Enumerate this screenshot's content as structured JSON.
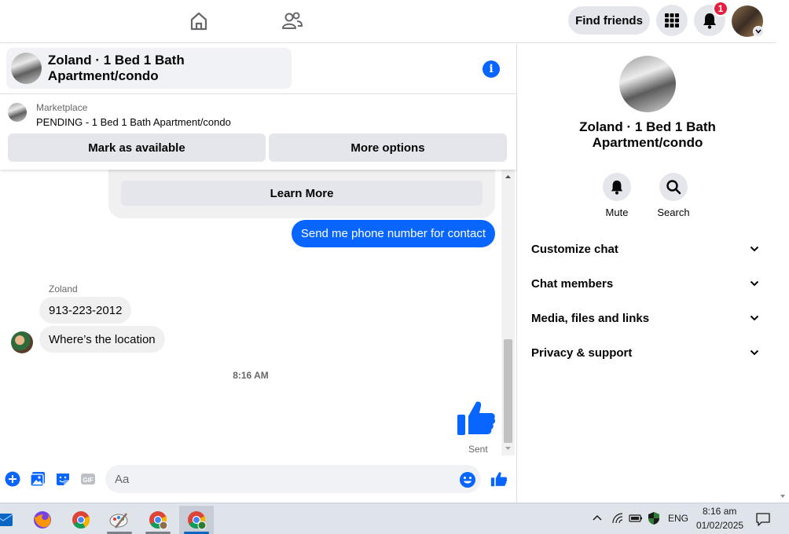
{
  "nav": {
    "find_friends": "Find friends",
    "notification_count": "1"
  },
  "chat": {
    "title": "Zoland · 1 Bed 1 Bath Apartment/condo"
  },
  "marketplace": {
    "label": "Marketplace",
    "status": "PENDING - 1 Bed 1 Bath Apartment/condo",
    "mark_available": "Mark as available",
    "more_options": "More options"
  },
  "messages": {
    "learn_more": "Learn More",
    "outgoing_1": "Send me phone number for contact",
    "sender_name": "Zoland",
    "incoming_1": "913-223-2012",
    "incoming_2": "Where’s the location",
    "timestamp": "8:16 AM",
    "sent_label": "Sent"
  },
  "composer": {
    "placeholder": "Aa"
  },
  "right_panel": {
    "title": "Zoland · 1 Bed 1 Bath Apartment/condo",
    "mute_label": "Mute",
    "search_label": "Search",
    "sections": [
      "Customize chat",
      "Chat members",
      "Media, files and links",
      "Privacy & support"
    ]
  },
  "taskbar": {
    "language": "ENG",
    "time": "8:16 am",
    "date": "01/02/2025"
  },
  "colors": {
    "accent": "#0866ff",
    "badge": "#e41e3f"
  }
}
